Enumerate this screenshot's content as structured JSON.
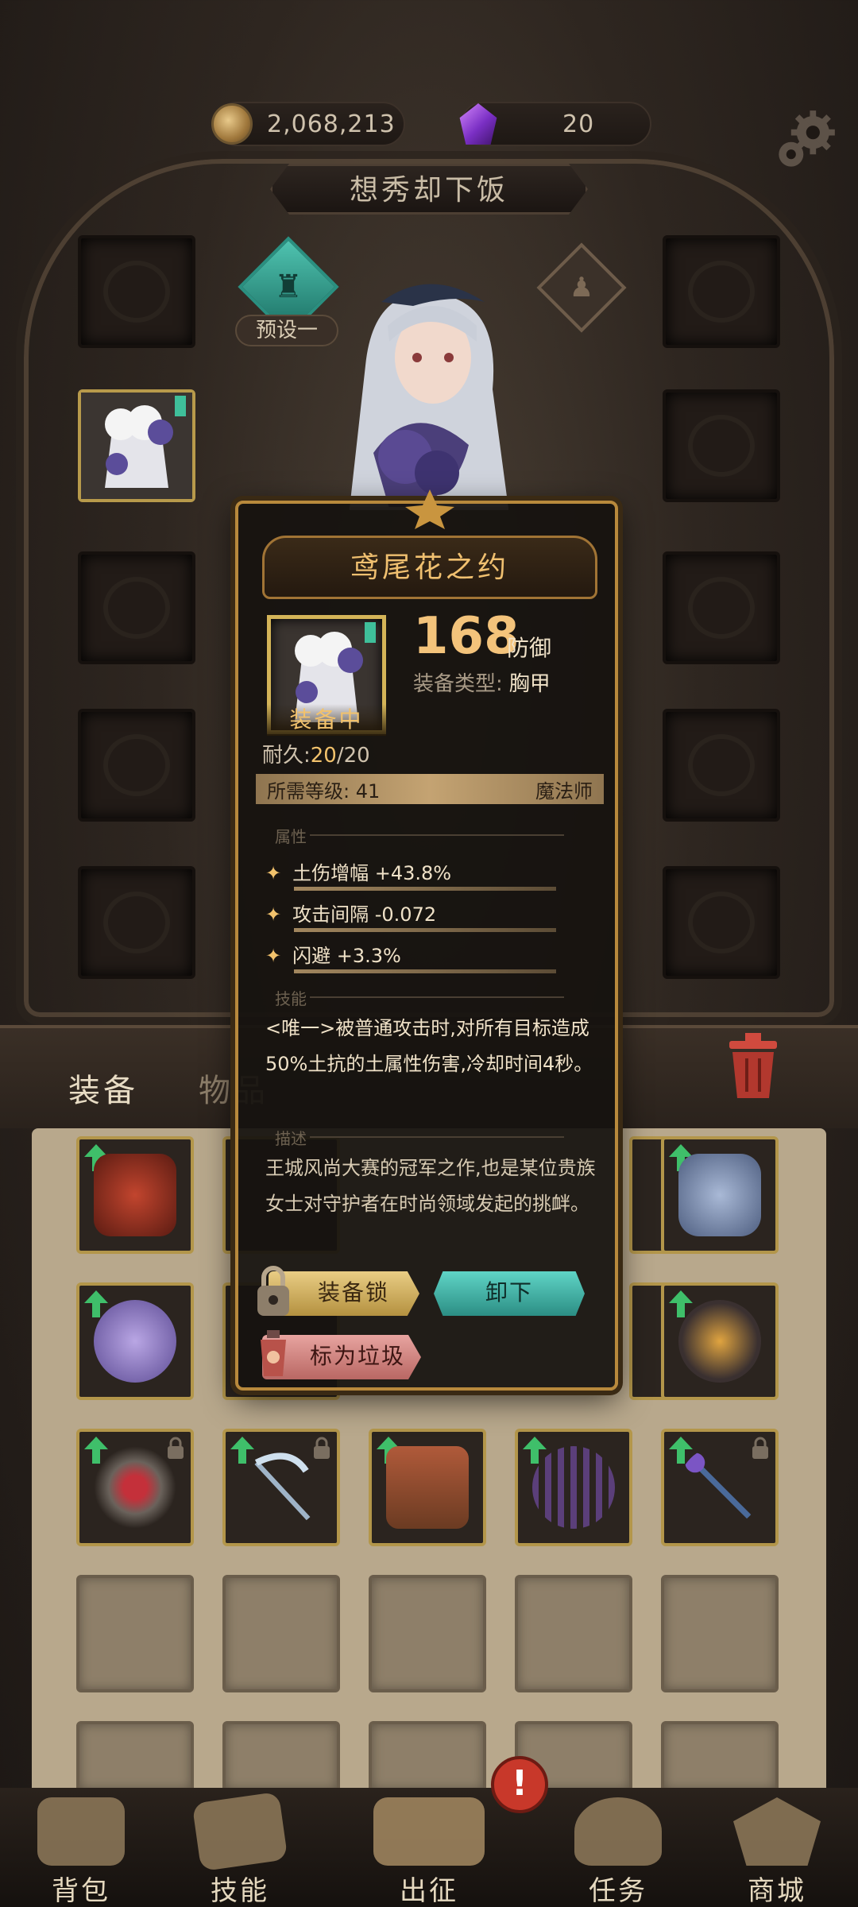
{
  "currency": {
    "gold": "2,068,213",
    "gems": "20"
  },
  "character": {
    "name": "想秀却下饭",
    "preset_label": "预设一"
  },
  "tabs": {
    "equip": "装备",
    "items": "物品"
  },
  "popup": {
    "title": "鸢尾花之约",
    "equipped_label": "装备中",
    "armor_value": "168",
    "armor_unit": "防御",
    "equip_type_label": "装备类型:",
    "equip_type": "胸甲",
    "durability_label": "耐久:",
    "durability_current": "20",
    "durability_max": "/20",
    "required_level": "所需等级: 41",
    "class": "魔法师",
    "section_attributes": "属性",
    "attributes": [
      {
        "star": "✦",
        "text": "土伤增幅 +43.8%"
      },
      {
        "star": "✦",
        "text": "攻击间隔 -0.072"
      },
      {
        "star": "✦",
        "text": "闪避 +3.3%"
      }
    ],
    "section_skill": "技能",
    "skill_text": "<唯一>被普通攻击时,对所有目标造成50%土抗的土属性伤害,冷却时间4秒。",
    "section_desc": "描述",
    "desc_text": "王城风尚大赛的冠军之作,也是某位贵族女士对守护者在时尚领域发起的挑衅。",
    "btn_lock": "装备锁",
    "btn_unequip": "卸下",
    "btn_junk": "标为垃圾"
  },
  "nav": {
    "items": [
      {
        "label": "背包"
      },
      {
        "label": "技能"
      },
      {
        "label": "出征"
      },
      {
        "label": "任务"
      },
      {
        "label": "商城"
      }
    ],
    "alert": "!"
  },
  "colors": {
    "accent_gold": "#f2c26c",
    "teal": "#4fc3b0",
    "upgrade_green": "#3fbf6a"
  }
}
